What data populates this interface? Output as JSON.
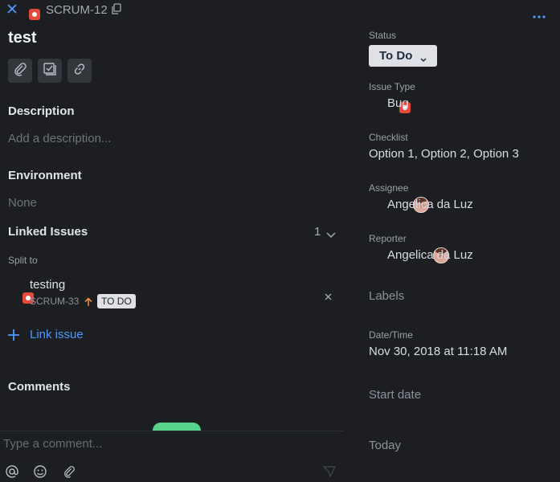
{
  "header": {
    "issue_key": "SCRUM-12",
    "title": "test"
  },
  "description": {
    "heading": "Description",
    "placeholder": "Add a description..."
  },
  "environment": {
    "heading": "Environment",
    "value": "None"
  },
  "linked_issues": {
    "heading": "Linked Issues",
    "count": "1",
    "relation": "Split to",
    "items": [
      {
        "title": "testing",
        "key": "SCRUM-33",
        "status": "TO DO"
      }
    ],
    "link_label": "Link issue"
  },
  "comments": {
    "heading": "Comments",
    "placeholder": "Type a comment..."
  },
  "fields": {
    "status_label": "Status",
    "status_value": "To Do",
    "issue_type_label": "Issue Type",
    "issue_type_value": "Bug",
    "checklist_label": "Checklist",
    "checklist_value": "Option 1, Option 2, Option 3",
    "assignee_label": "Assignee",
    "assignee_value": "Angelica da Luz",
    "reporter_label": "Reporter",
    "reporter_value": "Angelica da Luz",
    "labels_label": "Labels",
    "datetime_label": "Date/Time",
    "datetime_value": "Nov 30, 2018 at 11:18 AM",
    "start_date_label": "Start date",
    "today_label": "Today"
  },
  "colors": {
    "accent": "#4c9aff",
    "bug": "#e5493a",
    "priority": "#f08a3c"
  },
  "icons": [
    "close-icon",
    "copy-icon",
    "more-icon",
    "attach-icon",
    "checklist-icon",
    "link-icon",
    "chevron-down-icon",
    "priority-arrow-icon",
    "remove-icon",
    "plus-icon",
    "mention-icon",
    "emoji-icon",
    "send-icon"
  ]
}
